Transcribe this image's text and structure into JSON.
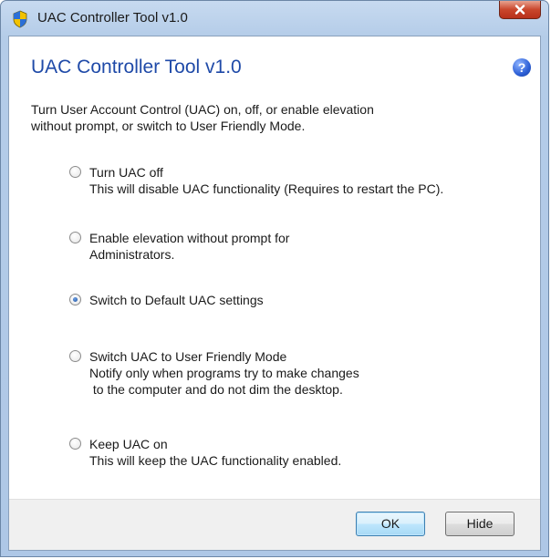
{
  "window": {
    "title": "UAC Controller Tool v1.0"
  },
  "header": {
    "heading": "UAC Controller Tool v1.0",
    "help_glyph": "?"
  },
  "description": {
    "line1": "Turn User Account Control (UAC) on, off, or enable elevation",
    "line2": "without prompt, or switch to User Friendly Mode."
  },
  "options": [
    {
      "title": "Turn UAC off",
      "lines": [
        "This will disable UAC functionality (Requires to restart the PC)."
      ],
      "checked": false
    },
    {
      "title": "Enable elevation without prompt for",
      "lines": [
        "Administrators."
      ],
      "checked": false
    },
    {
      "title": "Switch to Default UAC settings",
      "lines": [],
      "checked": true
    },
    {
      "title": "Switch UAC to User Friendly Mode",
      "lines": [
        "Notify only when programs try to make changes",
        " to the computer and do not dim the desktop."
      ],
      "checked": false
    },
    {
      "title": "Keep UAC on",
      "lines": [
        "This will keep the UAC functionality enabled."
      ],
      "checked": false
    }
  ],
  "footer": {
    "ok_label": "OK",
    "hide_label": "Hide"
  },
  "colors": {
    "heading": "#1f4aa8",
    "close_button": "#c9462c"
  }
}
